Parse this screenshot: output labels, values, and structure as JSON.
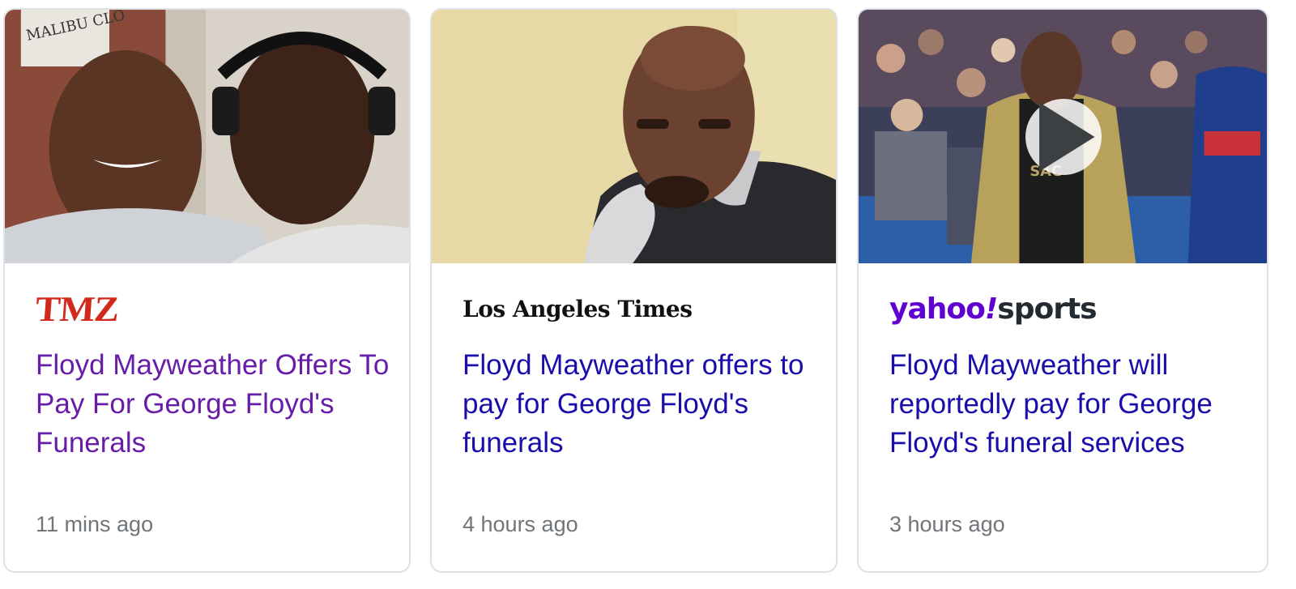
{
  "cards": [
    {
      "source": "TMZ",
      "headline": "Floyd Mayweather Offers To Pay For George Floyd's Funerals",
      "time": "11 mins ago",
      "visited": true,
      "has_video": false
    },
    {
      "source": "Los Angeles Times",
      "headline": "Floyd Mayweather offers to pay for George Floyd's funerals",
      "time": "4 hours ago",
      "visited": false,
      "has_video": false
    },
    {
      "source": "yahoo!sports",
      "source_parts": [
        "yahoo",
        "!",
        "sports"
      ],
      "headline": "Floyd Mayweather will reportedly pay for George Floyd's funeral services",
      "time": "3 hours ago",
      "visited": false,
      "has_video": true
    }
  ],
  "thumbnail_text": {
    "card1_sign": "MALIBU CLO",
    "card3_jersey": "SAC"
  },
  "colors": {
    "visited_link": "#681da8",
    "link": "#1a0dab",
    "meta": "#70757a",
    "tmz_red": "#d12a1c",
    "yahoo_purple": "#6001d2",
    "card_border": "#dfe1e5"
  }
}
